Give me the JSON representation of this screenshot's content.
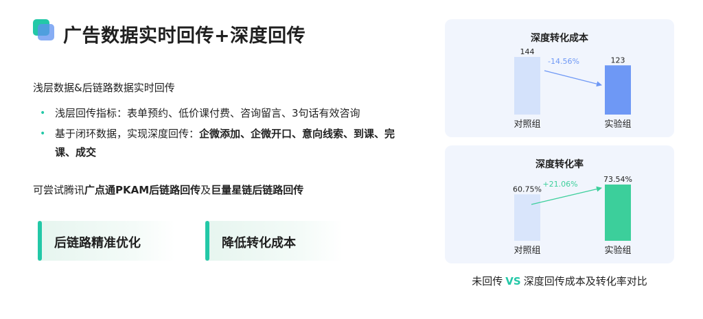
{
  "header": {
    "title": "广告数据实时回传+深度回传"
  },
  "left": {
    "subtitle": "浅层数据&后链路数据实时回传",
    "bullet1": "浅层回传指标：表单预约、低价课付费、咨询留言、3句话有效咨询",
    "bullet2_prefix": "基于闭环数据，实现深度回传：",
    "bullet2_bold": "企微添加、企微开口、意向线索、到课、完课、成交",
    "try_prefix": "可尝试腾讯",
    "try_bold1": "广点通PKAM后链路回传",
    "try_mid": "及",
    "try_bold2": "巨量星链后链路回传",
    "card1": "后链路精准优化",
    "card2": "降低转化成本"
  },
  "chart_data": [
    {
      "type": "bar",
      "title": "深度转化成本",
      "categories": [
        "对照组",
        "实验组"
      ],
      "values": [
        144,
        123
      ],
      "value_labels": [
        "144",
        "123"
      ],
      "change_label": "-14.56%",
      "colors": [
        "#d4e2fb",
        "#6e98f5"
      ],
      "change_color": "#6e98f5"
    },
    {
      "type": "bar",
      "title": "深度转化率",
      "categories": [
        "对照组",
        "实验组"
      ],
      "values": [
        60.75,
        73.54
      ],
      "value_labels": [
        "60.75%",
        "73.54%"
      ],
      "change_label": "+21.06%",
      "colors": [
        "#d9e5fb",
        "#3ccf9b"
      ],
      "change_color": "#3ccf9b"
    }
  ],
  "footer": {
    "prefix": "未回传",
    "vs": "VS",
    "suffix": "深度回传成本及转化率对比"
  }
}
